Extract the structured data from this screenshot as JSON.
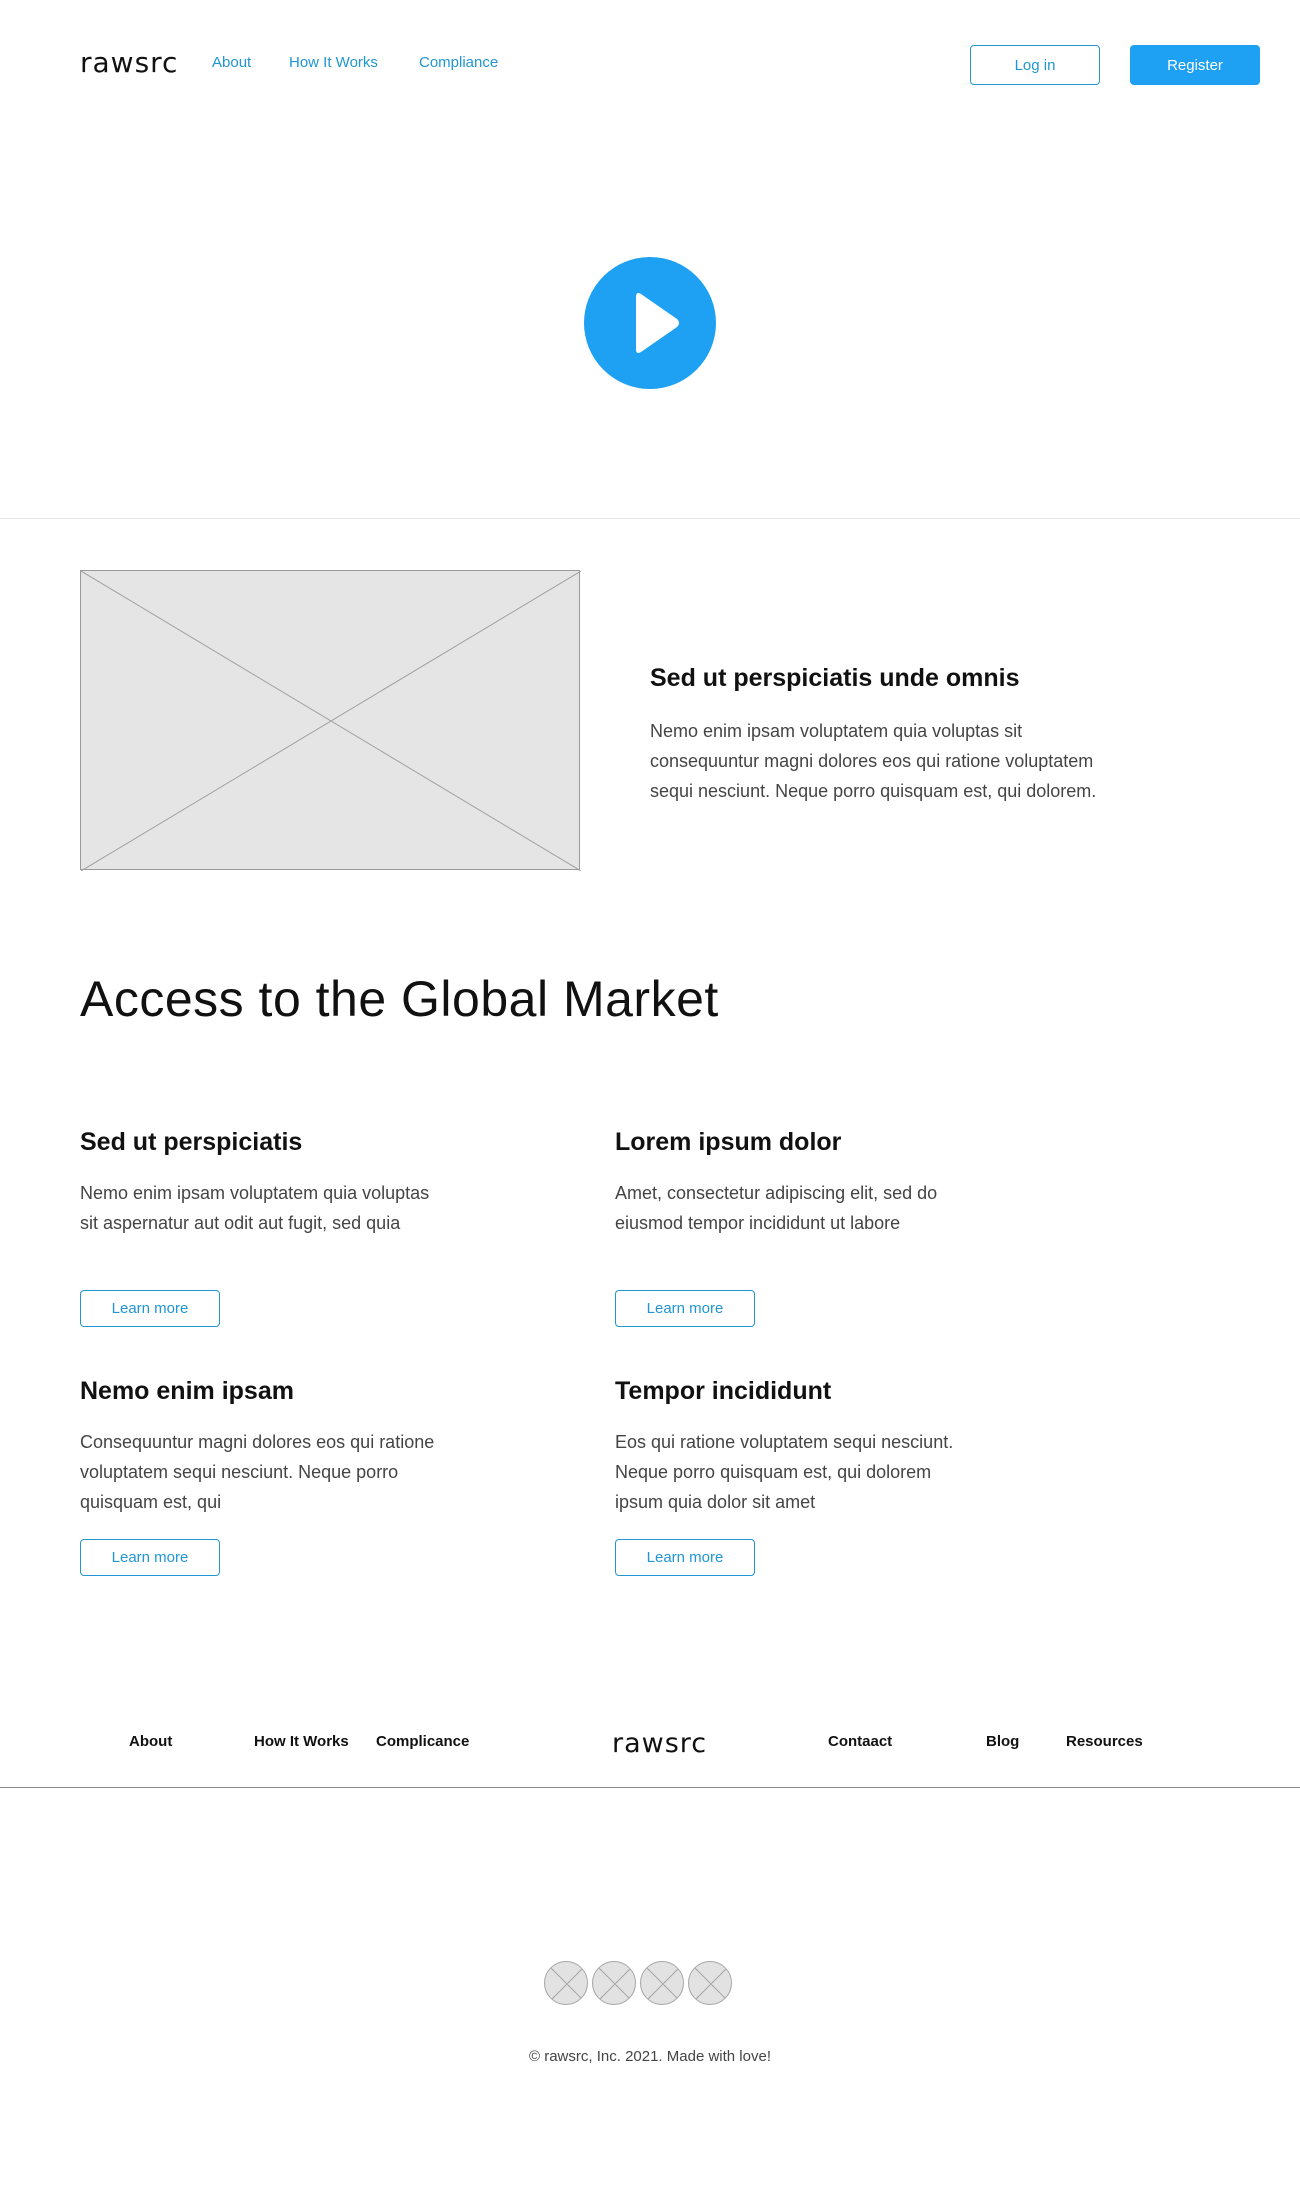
{
  "header": {
    "logo": "rawsrc",
    "nav": [
      "About",
      "How It Works",
      "Compliance"
    ],
    "login_label": "Log in",
    "register_label": "Register"
  },
  "hero": {
    "play_icon": "play-icon"
  },
  "feature": {
    "title": "Sed ut perspiciatis unde omnis",
    "text": "Nemo enim ipsam voluptatem quia voluptas sit consequuntur magni dolores eos qui ratione voluptatem sequi nesciunt. Neque porro quisquam est, qui dolorem."
  },
  "section": {
    "heading": "Access to the Global Market"
  },
  "cards": [
    {
      "title": "Sed ut perspiciatis",
      "text": "Nemo enim ipsam voluptatem quia voluptas sit aspernatur aut odit aut fugit, sed quia",
      "button": "Learn more"
    },
    {
      "title": "Lorem ipsum dolor",
      "text": "Amet, consectetur adipiscing elit, sed do eiusmod tempor incididunt ut labore",
      "button": "Learn more"
    },
    {
      "title": "Nemo enim ipsam",
      "text": "Consequuntur magni dolores eos qui ratione voluptatem sequi nesciunt. Neque porro quisquam est, qui",
      "button": "Learn more"
    },
    {
      "title": "Tempor incididunt",
      "text": "Eos qui ratione voluptatem sequi nesciunt. Neque porro quisquam est, qui dolorem ipsum quia dolor sit amet",
      "button": "Learn more"
    }
  ],
  "footer": {
    "links_left": [
      "About",
      "How It Works",
      "Complicance"
    ],
    "logo": "rawsrc",
    "links_right": [
      "Contaact",
      "Blog",
      "Resources"
    ],
    "copyright": "© rawsrc, Inc. 2021. Made with love!"
  },
  "colors": {
    "accent": "#1ea0f3",
    "link": "#2196d3",
    "placeholder": "#e5e5e5"
  }
}
